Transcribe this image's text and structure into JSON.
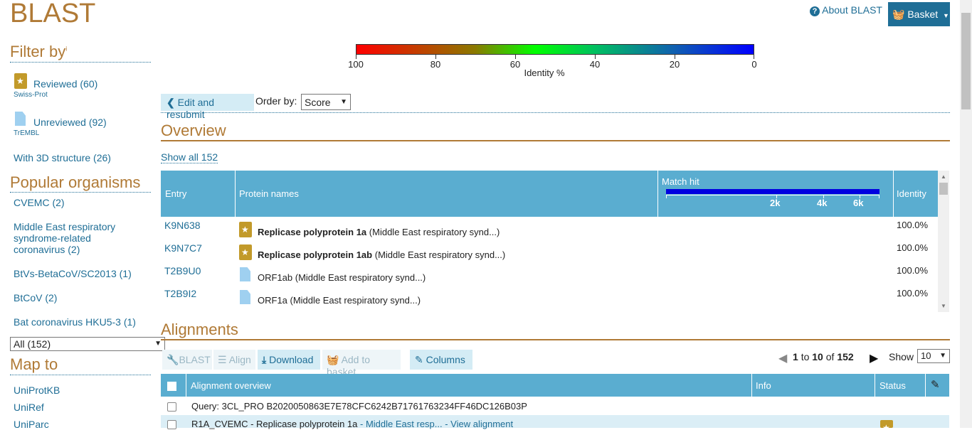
{
  "app": {
    "title": "BLAST"
  },
  "header": {
    "about_label": "About BLAST",
    "basket_label": "Basket"
  },
  "legend": {
    "ticks": [
      "100",
      "80",
      "60",
      "40",
      "20",
      "0"
    ],
    "label": "Identity %"
  },
  "sidebar": {
    "filter_title": "Filter by",
    "filter_info": "i",
    "reviewed": {
      "label": "Reviewed (60)",
      "sub": "Swiss-Prot"
    },
    "unreviewed": {
      "label": "Unreviewed (92)",
      "sub": "TrEMBL"
    },
    "with3d": "With 3D structure (26)",
    "popular_title": "Popular organisms",
    "organisms": [
      "CVEMC (2)",
      "Middle East respiratory",
      "syndrome-related",
      "coronavirus (2)",
      "BtVs-BetaCoV/SC2013 (1)",
      "BtCoV (2)",
      "Bat coronavirus HKU5-3 (1)"
    ],
    "all_select": "All (152)",
    "map_title": "Map to",
    "map_links": [
      "UniProtKB",
      "UniRef",
      "UniParc"
    ]
  },
  "controls": {
    "edit_label": "Edit and resubmit",
    "order_label": "Order by:",
    "order_value": "Score"
  },
  "overview": {
    "title": "Overview",
    "show_all": "Show all 152",
    "cols": {
      "entry": "Entry",
      "protein": "Protein names",
      "match": "Match hit",
      "identity": "Identity"
    },
    "scale": [
      "2k",
      "4k",
      "6k"
    ],
    "rows": [
      {
        "entry": "K9N638",
        "name_bold": "Replicase polyprotein 1a",
        "name_rest": "(Middle East respiratory synd...)",
        "identity": "100.0%"
      },
      {
        "entry": "K9N7C7",
        "name_bold": "Replicase polyprotein 1ab",
        "name_rest": "(Middle East respiratory synd...)",
        "identity": "100.0%"
      },
      {
        "entry": "T2B9U0",
        "name_bold": "",
        "name_rest": "ORF1ab (Middle East respiratory synd...)",
        "identity": "100.0%"
      },
      {
        "entry": "T2B9I2",
        "name_bold": "",
        "name_rest": "ORF1a (Middle East respiratory synd...)",
        "identity": "100.0%"
      }
    ]
  },
  "alignments": {
    "title": "Alignments",
    "toolbar": {
      "blast": "BLAST",
      "align": "Align",
      "download": "Download",
      "add_basket": "Add to basket",
      "columns": "Columns"
    },
    "pager": {
      "from": "1",
      "to_word": "to",
      "to": "10",
      "of_word": "of",
      "total": "152",
      "show_label": "Show",
      "show_value": "10"
    },
    "cols": {
      "overview": "Alignment overview",
      "info": "Info",
      "status": "Status"
    },
    "query": "Query: 3CL_PRO B2020050863E7E78CFC6242B71761763234FF46DC126B03P",
    "first_row": {
      "entry": "R1A_CVEMC",
      "sep": " - ",
      "name": "Replicase polyprotein 1a",
      "org": " - Middle East resp...",
      "view": " - View alignment"
    }
  },
  "colors": {
    "accent": "#b07a36",
    "link": "#1f6e96",
    "table_header": "#5aadd0",
    "basket": "#1f6e96"
  }
}
